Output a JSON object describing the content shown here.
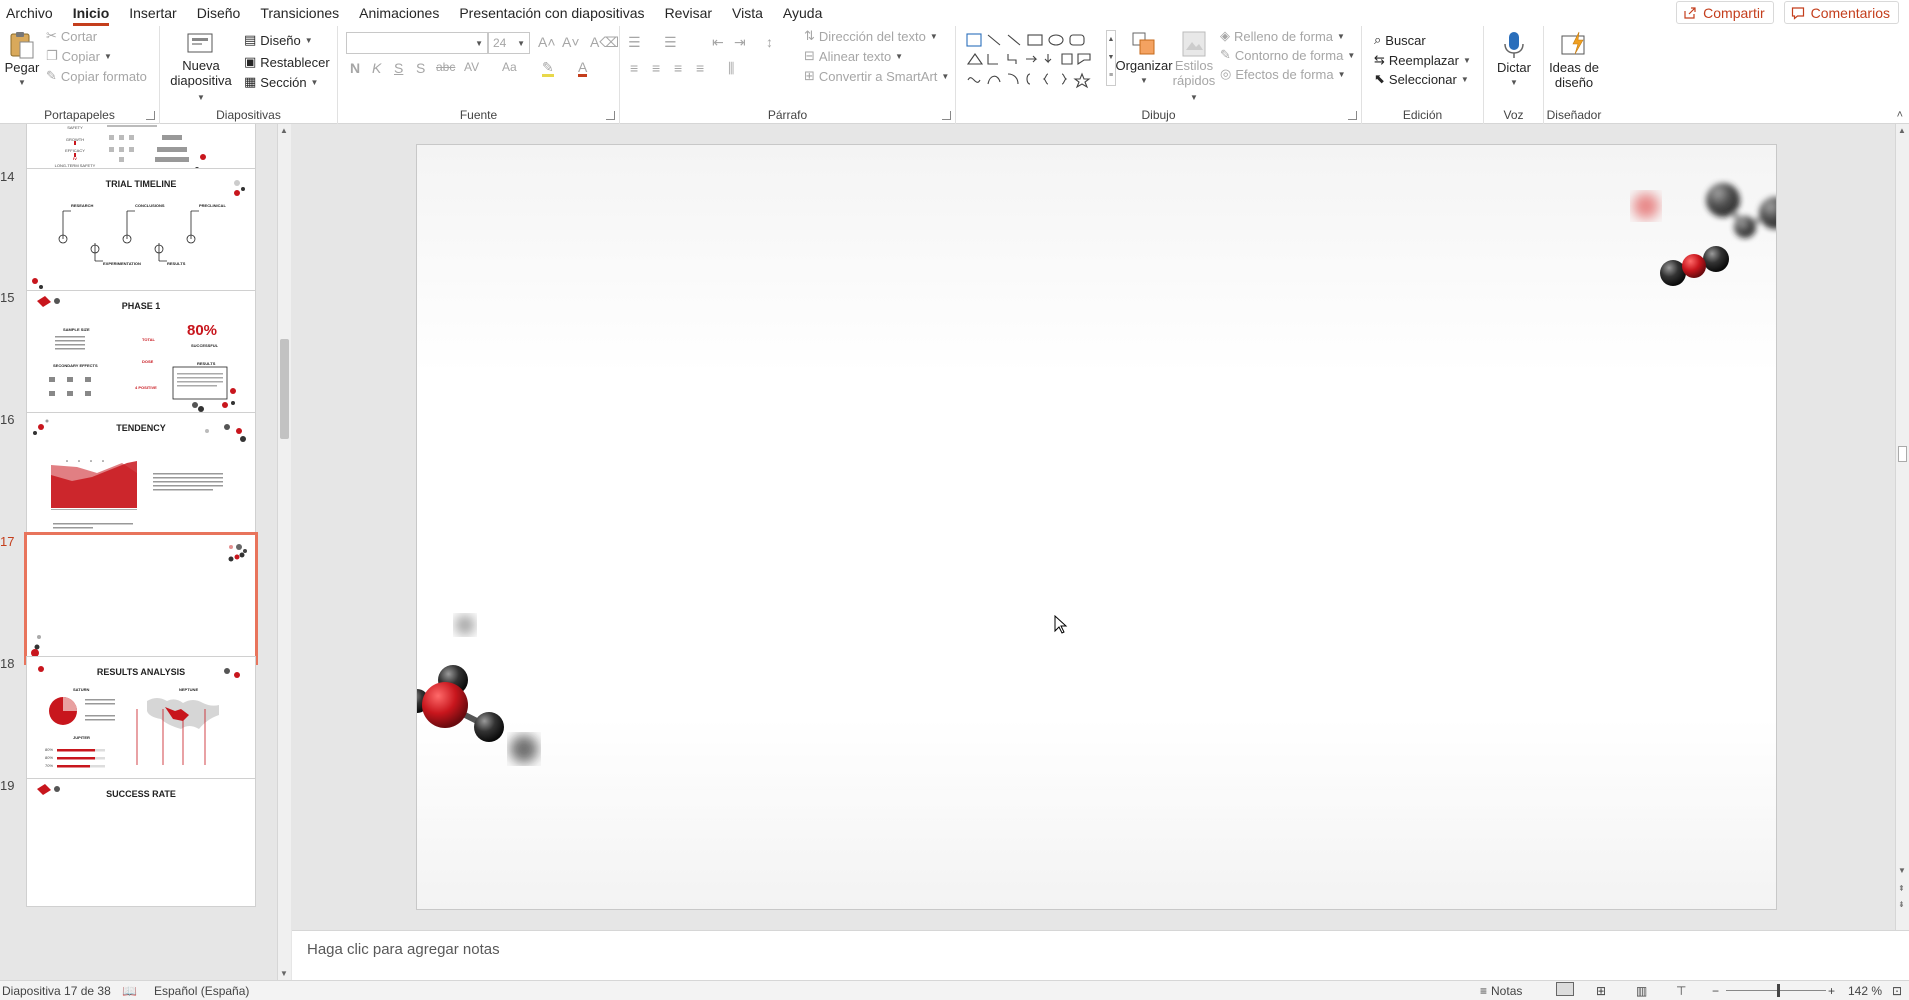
{
  "menu": {
    "tabs": [
      "Archivo",
      "Inicio",
      "Insertar",
      "Diseño",
      "Transiciones",
      "Animaciones",
      "Presentación con diapositivas",
      "Revisar",
      "Vista",
      "Ayuda"
    ],
    "active_tab": "Inicio",
    "share_label": "Compartir",
    "comments_label": "Comentarios"
  },
  "ribbon": {
    "portapapeles": {
      "label": "Portapapeles",
      "paste": "Pegar",
      "cut": "Cortar",
      "copy": "Copiar",
      "format_painter": "Copiar formato"
    },
    "diapositivas": {
      "label": "Diapositivas",
      "new_slide_1": "Nueva",
      "new_slide_2": "diapositiva",
      "layout": "Diseño",
      "reset": "Restablecer",
      "section": "Sección"
    },
    "fuente": {
      "label": "Fuente",
      "font_name": "",
      "font_size": "24",
      "bold": "N",
      "italic": "K",
      "underline": "S",
      "shadow": "S",
      "strike": "abc",
      "spacing": "AV",
      "case": "Aa"
    },
    "parrafo": {
      "label": "Párrafo",
      "text_direction": "Dirección del texto",
      "align_text": "Alinear texto",
      "smartart": "Convertir a SmartArt"
    },
    "dibujo": {
      "label": "Dibujo",
      "arrange": "Organizar",
      "quick_styles_1": "Estilos",
      "quick_styles_2": "rápidos",
      "shape_fill": "Relleno de forma",
      "shape_outline": "Contorno de forma",
      "shape_effects": "Efectos de forma"
    },
    "edicion": {
      "label": "Edición",
      "find": "Buscar",
      "replace": "Reemplazar",
      "select": "Seleccionar"
    },
    "voz": {
      "label": "Voz",
      "dictate": "Dictar"
    },
    "disenador": {
      "label": "Diseñador",
      "ideas_1": "Ideas de",
      "ideas_2": "diseño"
    }
  },
  "thumbnails": [
    {
      "num": "",
      "title": ""
    },
    {
      "num": "14",
      "title": "TRIAL TIMELINE"
    },
    {
      "num": "15",
      "title": "PHASE 1"
    },
    {
      "num": "16",
      "title": "TENDENCY"
    },
    {
      "num": "17",
      "title": ""
    },
    {
      "num": "18",
      "title": "RESULTS ANALYSIS"
    },
    {
      "num": "19",
      "title": "SUCCESS RATE"
    }
  ],
  "thumb_details": {
    "t14": [
      "RESEARCH",
      "CONCLUSIONS",
      "PRECLINICAL",
      "EXPERIMENTATION",
      "RESULTS"
    ],
    "t15": {
      "sample": "SAMPLE SIZE",
      "effects": "SECONDARY EFFECTS",
      "percent": "80%",
      "success": "SUCCESSFUL",
      "results": "RESULTS",
      "total": "TOTAL",
      "dose": "DOSE",
      "positive": "4 POSITIVE"
    },
    "t18": {
      "saturn": "SATURN",
      "neptune": "NEPTUNE",
      "jupiter": "JUPITER",
      "p1": "80%",
      "p2": "80%",
      "p3": "70%"
    },
    "t13": [
      "SAFETY",
      "GROWTH",
      "EFFICACY",
      "IV",
      "LONG-TERM SAFETY"
    ]
  },
  "notes": {
    "placeholder": "Haga clic para agregar notas"
  },
  "status": {
    "slide_info": "Diapositiva 17 de 38",
    "language": "Español (España)",
    "notes": "Notas",
    "zoom": "142 %"
  },
  "colors": {
    "accent": "#c43e1c",
    "molecule_red": "#c8161d",
    "selection": "#e8745c"
  }
}
